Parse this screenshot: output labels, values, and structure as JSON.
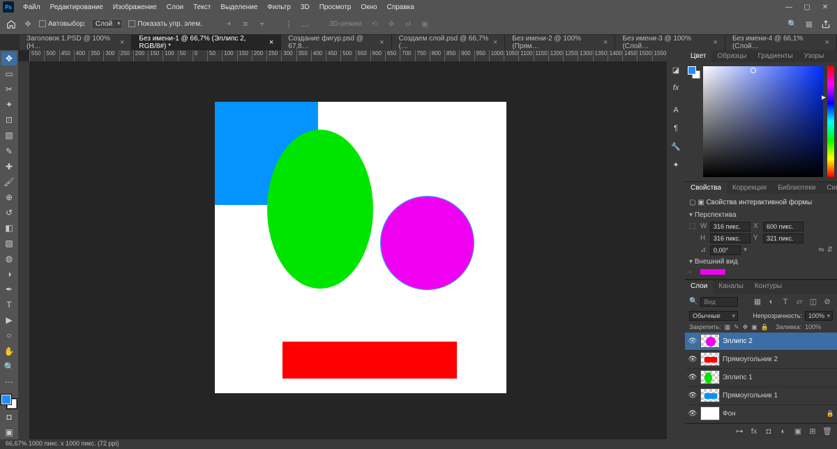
{
  "app": {
    "logo": "Ps"
  },
  "menu": [
    "Файл",
    "Редактирование",
    "Изображение",
    "Слои",
    "Текст",
    "Выделение",
    "Фильтр",
    "3D",
    "Просмотр",
    "Окно",
    "Справка"
  ],
  "options": {
    "autoselect_label": "Автовыбор:",
    "autoselect_value": "Слой",
    "show_controls": "Показать упр. элем.",
    "mode3d": "3D-режим:"
  },
  "tabs": [
    {
      "label": "Заголовок 1.PSD @ 100% (Н…"
    },
    {
      "label": "Без имени-1 @ 66,7% (Эллипс 2, RGB/8#) *",
      "active": true
    },
    {
      "label": "Создание фигур.psd @ 67,8…"
    },
    {
      "label": "Создаем слой.psd @ 66,7% (…"
    },
    {
      "label": "Без имени-2 @ 100% (Прям…"
    },
    {
      "label": "Без имени-3 @ 100% (Слой…"
    },
    {
      "label": "Без имени-4 @ 66,1% (Слой…"
    }
  ],
  "ruler": [
    "550",
    "500",
    "450",
    "400",
    "350",
    "300",
    "250",
    "200",
    "150",
    "100",
    "50",
    "0",
    "50",
    "100",
    "150",
    "200",
    "250",
    "300",
    "350",
    "400",
    "450",
    "500",
    "550",
    "600",
    "650",
    "700",
    "750",
    "800",
    "850",
    "900",
    "950",
    "1000",
    "1050",
    "1100",
    "1150",
    "1200",
    "1250",
    "1300",
    "1350",
    "1400",
    "1450",
    "1500",
    "1550"
  ],
  "color_tabs": [
    "Цвет",
    "Образцы",
    "Градиенты",
    "Узоры"
  ],
  "props": {
    "panel_tabs": [
      "Свойства",
      "Коррекция",
      "Библиотеки",
      "Символ"
    ],
    "title": "Свойства интерактивной формы",
    "section_transform": "Перспектива",
    "W_label": "W",
    "W": "316 пикс.",
    "X_label": "X",
    "X": "600 пикс.",
    "H_label": "H",
    "H": "316 пикс.",
    "Y_label": "Y",
    "Y": "321 пикс.",
    "angle_label": "⊿",
    "angle": "0,00°",
    "section_appearance": "Внешний вид"
  },
  "layers_panel": {
    "tabs": [
      "Слои",
      "Каналы",
      "Контуры"
    ],
    "search_icon": "🔍",
    "search_label": "Вид",
    "blend": "Обычные",
    "opacity_label": "Непрозрачность:",
    "opacity": "100%",
    "lock_label": "Закрепить:",
    "fill_label": "Заливка:",
    "fill": "100%",
    "layers": [
      {
        "name": "Эллипс 2",
        "color": "#f000f0",
        "shape": "circle",
        "selected": true
      },
      {
        "name": "Прямоугольник 2",
        "color": "#ff0000",
        "shape": "rect"
      },
      {
        "name": "Эллипс 1",
        "color": "#00e500",
        "shape": "ellipse"
      },
      {
        "name": "Прямоугольник 1",
        "color": "#0594ff",
        "shape": "rect"
      },
      {
        "name": "Фон",
        "color": "#ffffff",
        "shape": "bg"
      }
    ]
  },
  "status": "66,67%    1000 пикс. x 1000 пикс. (72 ppi)"
}
